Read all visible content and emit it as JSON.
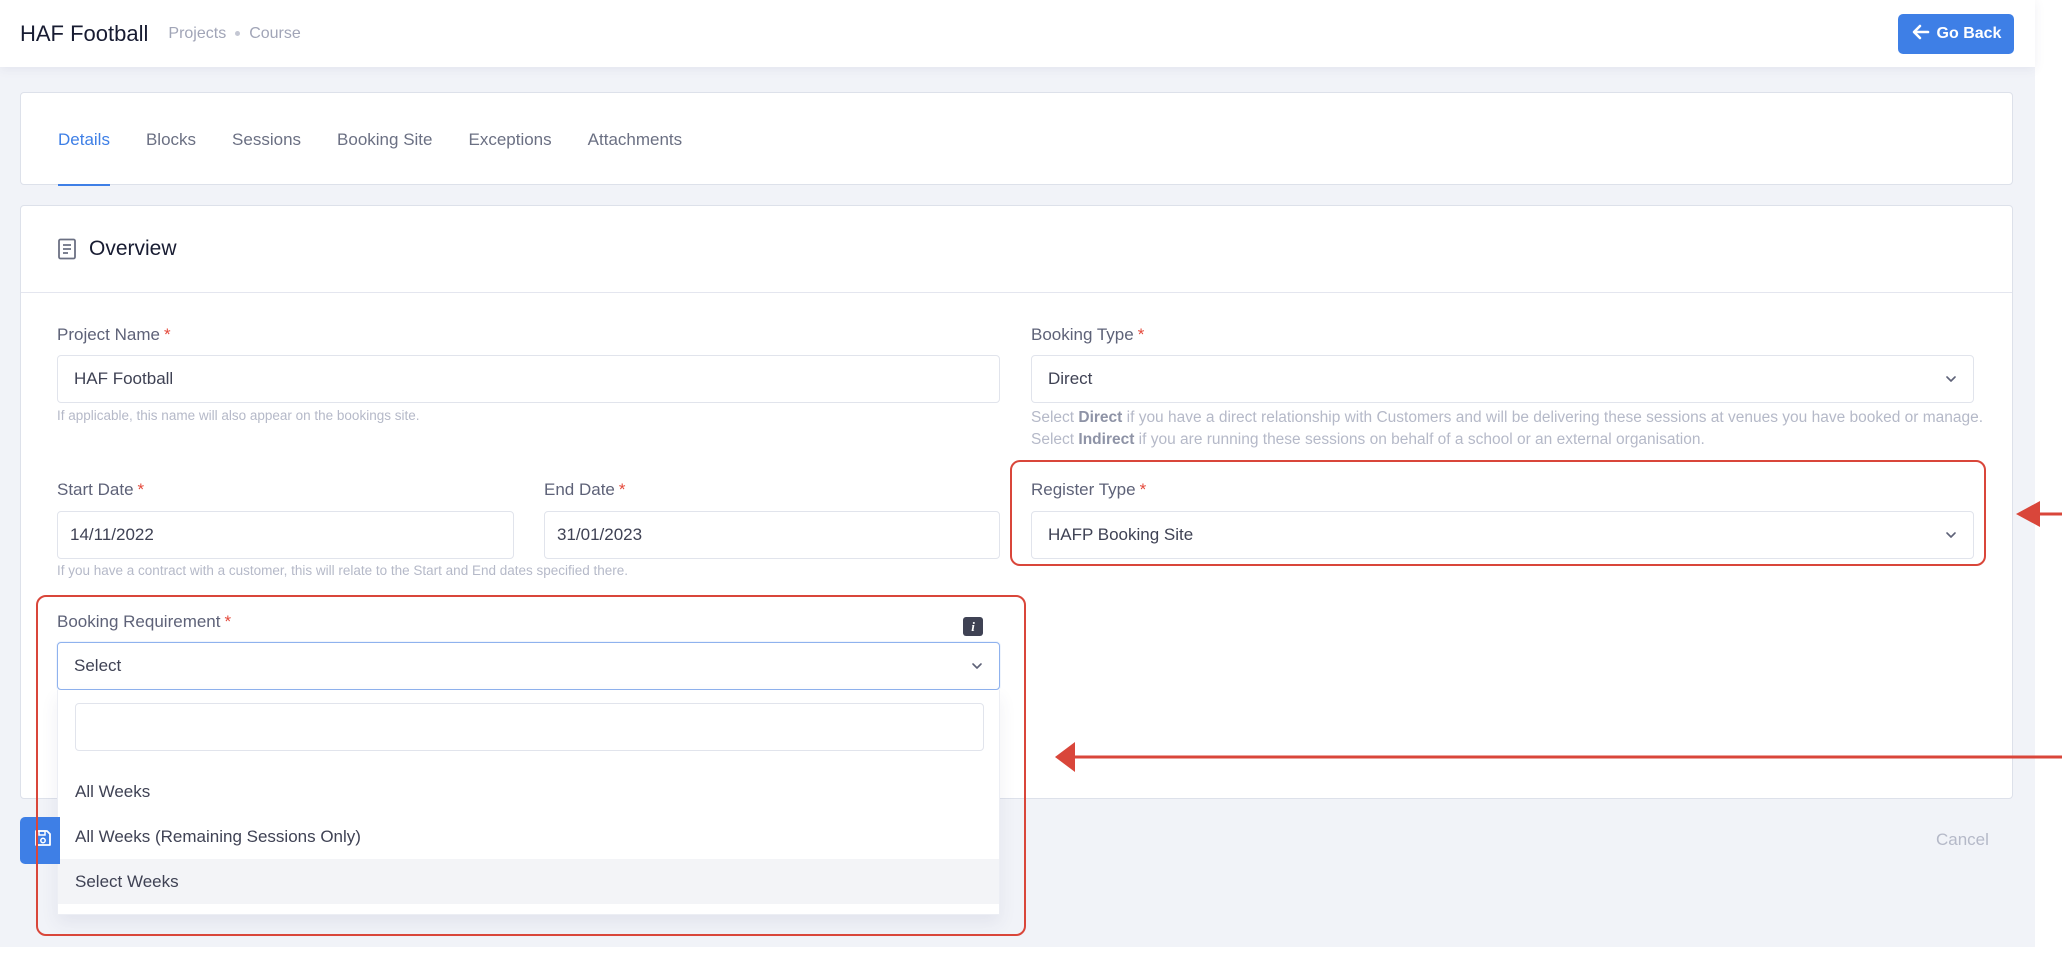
{
  "header": {
    "title": "HAF Football",
    "breadcrumb": [
      "Projects",
      "Course"
    ],
    "go_back_label": "Go Back"
  },
  "tabs": [
    {
      "label": "Details",
      "active": true
    },
    {
      "label": "Blocks",
      "active": false
    },
    {
      "label": "Sessions",
      "active": false
    },
    {
      "label": "Booking Site",
      "active": false
    },
    {
      "label": "Exceptions",
      "active": false
    },
    {
      "label": "Attachments",
      "active": false
    }
  ],
  "overview": {
    "title": "Overview",
    "required_mark": "*",
    "project_name": {
      "label": "Project Name",
      "value": "HAF Football",
      "help": "If applicable, this name will also appear on the bookings site."
    },
    "booking_type": {
      "label": "Booking Type",
      "value": "Direct",
      "help": {
        "p1": "Select ",
        "direct": "Direct",
        "p2": " if you have a direct relationship with Customers and will be delivering these sessions at venues you have booked or manage. Select ",
        "indirect": "Indirect",
        "p3": " if you are running these sessions on behalf of a school or an external organisation."
      }
    },
    "start_date": {
      "label": "Start Date",
      "value": "14/11/2022"
    },
    "end_date": {
      "label": "End Date",
      "value": "31/01/2023"
    },
    "dates_help": "If you have a contract with a customer, this will relate to the Start and End dates specified there.",
    "register_type": {
      "label": "Register Type",
      "value": "HAFP Booking Site"
    },
    "booking_requirement": {
      "label": "Booking Requirement",
      "value": "Select",
      "info_glyph": "i",
      "search_value": "",
      "options": [
        "All Weeks",
        "All Weeks (Remaining Sessions Only)",
        "Select Weeks"
      ],
      "highlighted_option": "Select Weeks"
    }
  },
  "footer": {
    "cancel_label": "Cancel"
  },
  "colors": {
    "accent": "#3e7fe6",
    "annotation": "#d9463a",
    "required": "#e4493b"
  },
  "icons": {
    "go_back": "arrow-left-icon",
    "overview": "document-icon",
    "select": "chevron-down-icon",
    "save": "save-icon",
    "info": "info-icon"
  }
}
